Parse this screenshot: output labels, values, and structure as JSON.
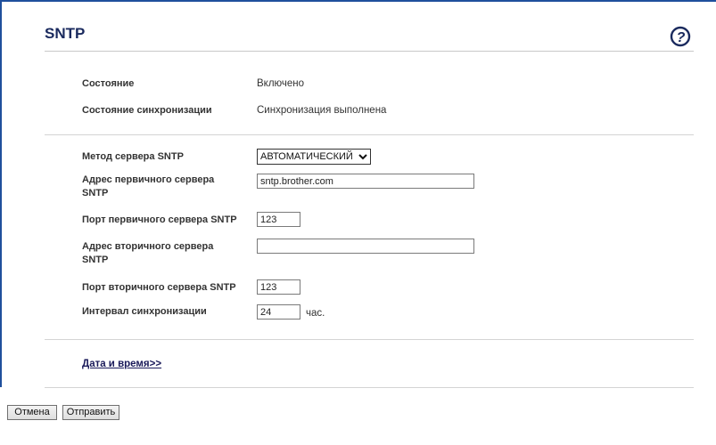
{
  "page": {
    "title": "SNTP"
  },
  "status": {
    "state_label": "Состояние",
    "state_value": "Включено",
    "sync_state_label": "Состояние синхронизации",
    "sync_state_value": "Синхронизация выполнена"
  },
  "form": {
    "method_label": "Метод сервера SNTP",
    "method_value": "АВТОМАТИЧЕСКИЙ",
    "primary_address_label_1": "Адрес первичного сервера",
    "primary_address_label_2": "SNTP",
    "primary_address_value": "sntp.brother.com",
    "primary_port_label": "Порт первичного сервера SNTP",
    "primary_port_value": "123",
    "secondary_address_label_1": "Адрес вторичного сервера",
    "secondary_address_label_2": "SNTP",
    "secondary_address_value": "",
    "secondary_port_label": "Порт вторичного сервера SNTP",
    "secondary_port_value": "123",
    "interval_label": "Интервал синхронизации",
    "interval_value": "24",
    "interval_unit": "час."
  },
  "links": {
    "date_time": "Дата и время>>"
  },
  "buttons": {
    "cancel": "Отмена",
    "submit": "Отправить"
  },
  "icons": {
    "help": "help-icon"
  },
  "colors": {
    "frame": "#1f4f9c",
    "title": "#1a2a5e"
  }
}
